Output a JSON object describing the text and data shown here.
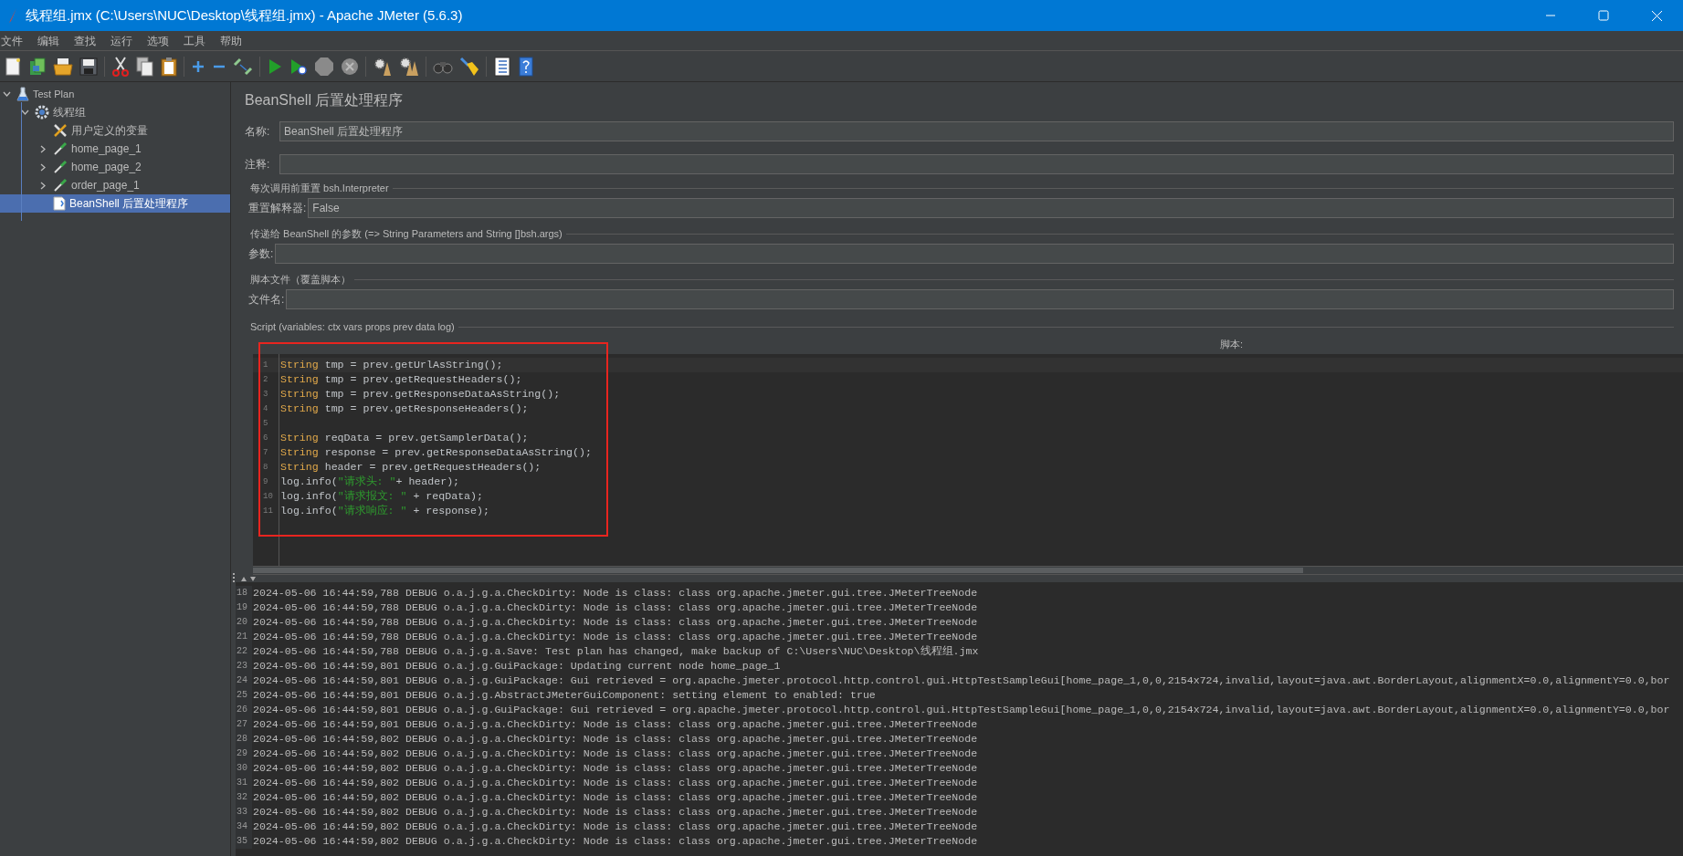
{
  "window": {
    "title": "线程组.jmx (C:\\Users\\NUC\\Desktop\\线程组.jmx) - Apache JMeter (5.6.3)"
  },
  "menu": [
    "文件",
    "编辑",
    "查找",
    "运行",
    "选项",
    "工具",
    "帮助"
  ],
  "tree": [
    {
      "label": "Test Plan",
      "kind": "plan",
      "expanded": true,
      "selected": false,
      "children": [
        {
          "label": "线程组",
          "kind": "group",
          "expanded": true,
          "selected": false,
          "children": [
            {
              "label": "用户定义的变量",
              "kind": "config",
              "selected": false
            },
            {
              "label": "home_page_1",
              "kind": "sampler",
              "expanded": false,
              "selected": false
            },
            {
              "label": "home_page_2",
              "kind": "sampler",
              "expanded": false,
              "selected": false
            },
            {
              "label": "order_page_1",
              "kind": "sampler",
              "expanded": false,
              "selected": false
            },
            {
              "label": "BeanShell 后置处理程序",
              "kind": "script",
              "selected": true
            }
          ]
        }
      ]
    }
  ],
  "panel": {
    "title": "BeanShell 后置处理程序",
    "name_field": {
      "label": "名称:",
      "value": "BeanShell 后置处理程序"
    },
    "comment_field": {
      "label": "注释:"
    },
    "sections": [
      {
        "legend": "每次调用前重置 bsh.Interpreter",
        "field_label": "重置解释器:",
        "value": "False"
      },
      {
        "legend": "传递给 BeanShell 的参数 (=> String Parameters and String []bsh.args)",
        "field_label": "参数:"
      },
      {
        "legend": "脚本文件（覆盖脚本）",
        "field_label": "文件名:"
      }
    ],
    "script_legend": "Script (variables: ctx vars props prev data log)",
    "script_label": "脚本:"
  },
  "code": {
    "lines": [
      {
        "number": "1",
        "tokens": [
          {
            "kind": "keyword",
            "text": "String"
          },
          {
            "kind": "plain",
            "text": " tmp = prev.getUrlAsString();"
          }
        ]
      },
      {
        "number": "2",
        "tokens": [
          {
            "kind": "keyword",
            "text": "String"
          },
          {
            "kind": "plain",
            "text": " tmp = prev.getRequestHeaders();"
          }
        ]
      },
      {
        "number": "3",
        "tokens": [
          {
            "kind": "keyword",
            "text": "String"
          },
          {
            "kind": "plain",
            "text": " tmp = prev.getResponseDataAsString();"
          }
        ]
      },
      {
        "number": "4",
        "tokens": [
          {
            "kind": "keyword",
            "text": "String"
          },
          {
            "kind": "plain",
            "text": " tmp = prev.getResponseHeaders();"
          }
        ]
      },
      {
        "number": "5"
      },
      {
        "number": "6",
        "tokens": [
          {
            "kind": "keyword",
            "text": "String"
          },
          {
            "kind": "plain",
            "text": " reqData = prev.getSamplerData();"
          }
        ]
      },
      {
        "number": "7",
        "tokens": [
          {
            "kind": "keyword",
            "text": "String"
          },
          {
            "kind": "plain",
            "text": " response = prev.getResponseDataAsString();"
          }
        ]
      },
      {
        "number": "8",
        "tokens": [
          {
            "kind": "keyword",
            "text": "String"
          },
          {
            "kind": "plain",
            "text": " header = prev.getRequestHeaders();"
          }
        ]
      },
      {
        "number": "9",
        "tokens": [
          {
            "kind": "plain",
            "text": "log.info("
          },
          {
            "kind": "string",
            "text": "\"请求头: \""
          },
          {
            "kind": "plain",
            "text": "+ header);"
          }
        ]
      },
      {
        "number": "10",
        "tokens": [
          {
            "kind": "plain",
            "text": "log.info("
          },
          {
            "kind": "string",
            "text": "\"请求报文: \""
          },
          {
            "kind": "plain",
            "text": " + reqData);"
          }
        ]
      },
      {
        "number": "11",
        "tokens": [
          {
            "kind": "plain",
            "text": "log.info("
          },
          {
            "kind": "string",
            "text": "\"请求响应: \""
          },
          {
            "kind": "plain",
            "text": " + response);"
          }
        ]
      }
    ],
    "highlight": {
      "kind": "rectangle"
    }
  },
  "log": {
    "lines": [
      {
        "number": "18",
        "text": "2024-05-06 16:44:59,788 DEBUG o.a.j.g.a.CheckDirty: Node is class: class org.apache.jmeter.gui.tree.JMeterTreeNode"
      },
      {
        "number": "19",
        "text": "2024-05-06 16:44:59,788 DEBUG o.a.j.g.a.CheckDirty: Node is class: class org.apache.jmeter.gui.tree.JMeterTreeNode"
      },
      {
        "number": "20",
        "text": "2024-05-06 16:44:59,788 DEBUG o.a.j.g.a.CheckDirty: Node is class: class org.apache.jmeter.gui.tree.JMeterTreeNode"
      },
      {
        "number": "21",
        "text": "2024-05-06 16:44:59,788 DEBUG o.a.j.g.a.CheckDirty: Node is class: class org.apache.jmeter.gui.tree.JMeterTreeNode"
      },
      {
        "number": "22",
        "text": "2024-05-06 16:44:59,788 DEBUG o.a.j.g.a.Save: Test plan has changed, make backup of C:\\Users\\NUC\\Desktop\\线程组.jmx"
      },
      {
        "number": "23",
        "text": "2024-05-06 16:44:59,801 DEBUG o.a.j.g.GuiPackage: Updating current node home_page_1"
      },
      {
        "number": "24",
        "text": "2024-05-06 16:44:59,801 DEBUG o.a.j.g.GuiPackage: Gui retrieved = org.apache.jmeter.protocol.http.control.gui.HttpTestSampleGui[home_page_1,0,0,2154x724,invalid,layout=java.awt.BorderLayout,alignmentX=0.0,alignmentY=0.0,bor"
      },
      {
        "number": "25",
        "text": "2024-05-06 16:44:59,801 DEBUG o.a.j.g.AbstractJMeterGuiComponent: setting element to enabled: true"
      },
      {
        "number": "26",
        "text": "2024-05-06 16:44:59,801 DEBUG o.a.j.g.GuiPackage: Gui retrieved = org.apache.jmeter.protocol.http.control.gui.HttpTestSampleGui[home_page_1,0,0,2154x724,invalid,layout=java.awt.BorderLayout,alignmentX=0.0,alignmentY=0.0,bor"
      },
      {
        "number": "27",
        "text": "2024-05-06 16:44:59,801 DEBUG o.a.j.g.a.CheckDirty: Node is class: class org.apache.jmeter.gui.tree.JMeterTreeNode"
      },
      {
        "number": "28",
        "text": "2024-05-06 16:44:59,802 DEBUG o.a.j.g.a.CheckDirty: Node is class: class org.apache.jmeter.gui.tree.JMeterTreeNode"
      },
      {
        "number": "29",
        "text": "2024-05-06 16:44:59,802 DEBUG o.a.j.g.a.CheckDirty: Node is class: class org.apache.jmeter.gui.tree.JMeterTreeNode"
      },
      {
        "number": "30",
        "text": "2024-05-06 16:44:59,802 DEBUG o.a.j.g.a.CheckDirty: Node is class: class org.apache.jmeter.gui.tree.JMeterTreeNode"
      },
      {
        "number": "31",
        "text": "2024-05-06 16:44:59,802 DEBUG o.a.j.g.a.CheckDirty: Node is class: class org.apache.jmeter.gui.tree.JMeterTreeNode"
      },
      {
        "number": "32",
        "text": "2024-05-06 16:44:59,802 DEBUG o.a.j.g.a.CheckDirty: Node is class: class org.apache.jmeter.gui.tree.JMeterTreeNode"
      },
      {
        "number": "33",
        "text": "2024-05-06 16:44:59,802 DEBUG o.a.j.g.a.CheckDirty: Node is class: class org.apache.jmeter.gui.tree.JMeterTreeNode"
      },
      {
        "number": "34",
        "text": "2024-05-06 16:44:59,802 DEBUG o.a.j.g.a.CheckDirty: Node is class: class org.apache.jmeter.gui.tree.JMeterTreeNode"
      },
      {
        "number": "35",
        "text": "2024-05-06 16:44:59,802 DEBUG o.a.j.g.a.CheckDirty: Node is class: class org.apache.jmeter.gui.tree.JMeterTreeNode"
      }
    ]
  }
}
